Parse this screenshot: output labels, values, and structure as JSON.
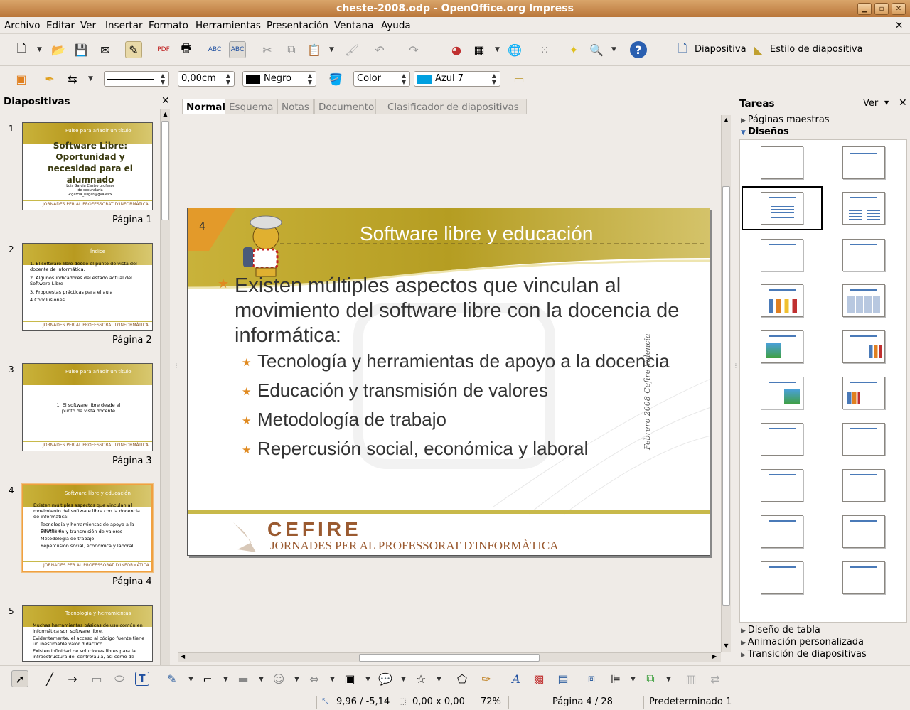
{
  "window": {
    "title": "cheste-2008.odp - OpenOffice.org Impress"
  },
  "menu": [
    "Archivo",
    "Editar",
    "Ver",
    "Insertar",
    "Formato",
    "Herramientas",
    "Presentación",
    "Ventana",
    "Ayuda"
  ],
  "toolbar1": {
    "slide_label": "Diapositiva",
    "slide_style_label": "Estilo de diapositiva"
  },
  "toolbar2": {
    "line_width": "0,00cm",
    "line_color": "Negro",
    "area_style": "Color",
    "area_color": "Azul 7",
    "area_color_hex": "#00a0e0"
  },
  "left_pane": {
    "title": "Diapositivas",
    "slides": [
      {
        "num": "1",
        "label": "Página 1",
        "header": "Pulse para añadir un título",
        "title": "Software Libre: Oportunidad y necesidad para el alumnado",
        "sub": "Luis Garcia Castro profesor de secundaria <garcia_luigar@gva.es>"
      },
      {
        "num": "2",
        "label": "Página 2",
        "header": "Índice",
        "items": [
          "1. El software libre desde el punto de vista del docente de informática.",
          "2. Algunos indicadores del estado actual del Software Libre",
          "3. Propuestas prácticas para el aula",
          "4.Conclusiones"
        ]
      },
      {
        "num": "3",
        "label": "Página 3",
        "header": "Pulse para añadir un título",
        "center": "1. El software libre desde el punto de vista docente"
      },
      {
        "num": "4",
        "label": "Página 4",
        "header": "Software libre y educación",
        "items": [
          "Existen múltiples aspectos que vinculan al movimiento del software libre con la docencia de informática:",
          "Tecnología y herramientas de apoyo a la docencia",
          "Educación y transmisión de valores",
          "Metodología de trabajo",
          "Repercusión social, económica y laboral"
        ]
      },
      {
        "num": "5",
        "label": "Página 5",
        "header": "Tecnología y herramientas",
        "items": [
          "Muchas herramientas básicas de uso común en informática son software libre.",
          "Evidentemente, el acceso al código fuente tiene un inestimable valor didáctico.",
          "Existen infinidad de soluciones libres para la infraestructura del centro/aula, así como de"
        ]
      }
    ],
    "footer_text": "JORNADES PER AL PROFESSORAT D'INFORMÀTICA"
  },
  "tabs": [
    "Normal",
    "Esquema",
    "Notas",
    "Documento",
    "Clasificador de diapositivas"
  ],
  "slide": {
    "number": "4",
    "title": "Software libre y educación",
    "bullet_main": "Existen múltiples aspectos que vinculan al movimiento del software libre con la docencia de informática:",
    "bullets": [
      "Tecnología y herramientas de apoyo a la docencia",
      "Educación y transmisión de valores",
      "Metodología de trabajo",
      "Repercusión social, económica y laboral"
    ],
    "side_note": "Febrero 2008 Cefire Valencia",
    "logo_text": "CEFIRE",
    "footer": "JORNADES PER AL PROFESSORAT D'INFORMÀTICA"
  },
  "right_pane": {
    "title": "Tareas",
    "view": "Ver",
    "master": "Páginas maestras",
    "layouts": "Diseños",
    "sections": [
      "Diseño de tabla",
      "Animación personalizada",
      "Transición de diapositivas"
    ]
  },
  "status": {
    "position": "9,96 / -5,14",
    "size": "0,00 x 0,00",
    "zoom": "72%",
    "page": "Página 4 / 28",
    "master": "Predeterminado 1"
  },
  "colors": {
    "accent": "#f0901e",
    "olive": "#b8a22a",
    "titlebar": "#c98a4a"
  }
}
